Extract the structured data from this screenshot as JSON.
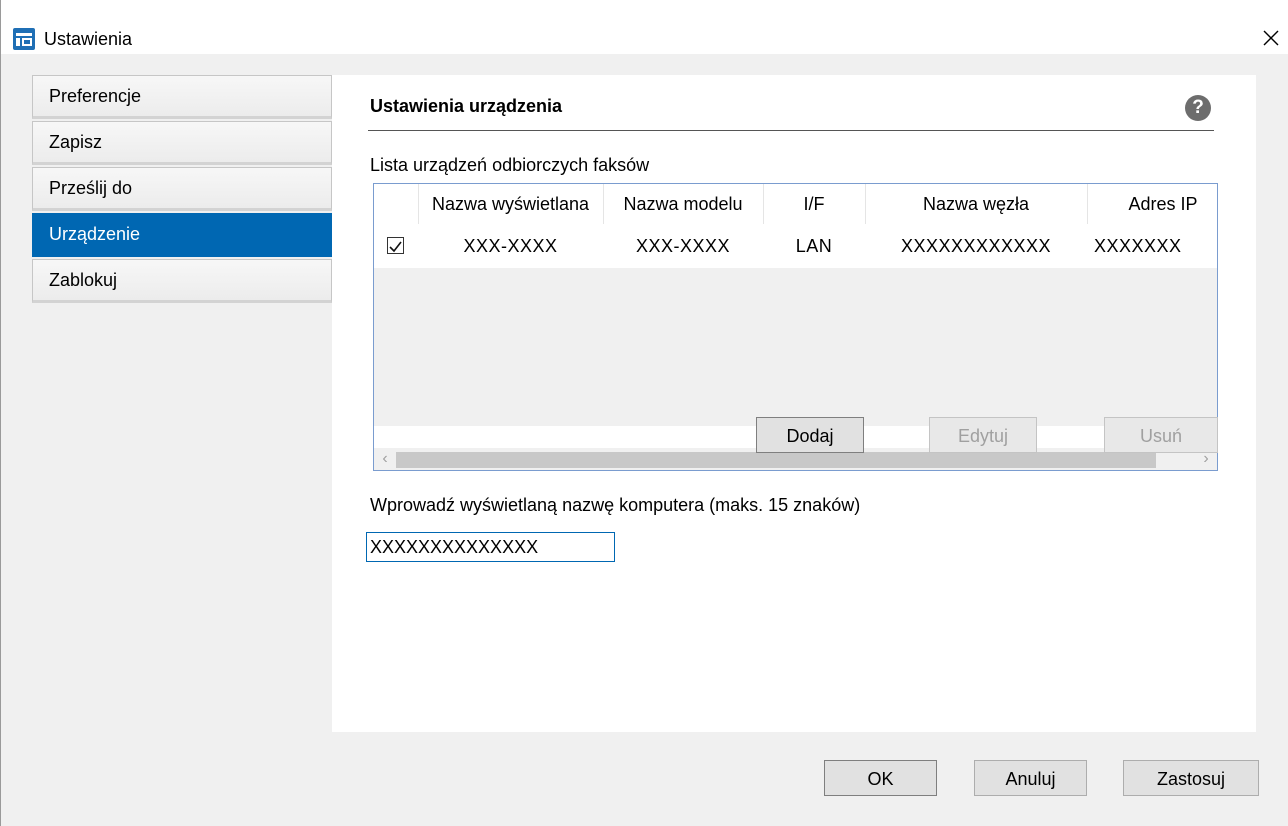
{
  "window": {
    "title": "Ustawienia",
    "close_glyph": "✕",
    "app_icon": "settings-window-icon"
  },
  "nav": {
    "items": [
      {
        "label": "Preferencje",
        "active": false
      },
      {
        "label": "Zapisz",
        "active": false
      },
      {
        "label": "Prześlij do",
        "active": false
      },
      {
        "label": "Urządzenie",
        "active": true
      },
      {
        "label": "Zablokuj",
        "active": false
      }
    ]
  },
  "panel": {
    "title": "Ustawienia urządzenia",
    "help_glyph": "?",
    "list_label": "Lista urządzeń odbiorczych faksów",
    "table": {
      "columns": [
        "Nazwa wyświetlana",
        "Nazwa modelu",
        "I/F",
        "Nazwa węzła",
        "Adres IP"
      ],
      "rows": [
        {
          "checked": true,
          "cells": [
            "XXX-XXXX",
            "XXX-XXXX",
            "LAN",
            "XXXXXXXXXXXX",
            "XXXXXXX"
          ]
        }
      ],
      "scroll_left_glyph": "‹",
      "scroll_right_glyph": "›"
    },
    "buttons": {
      "add": "Dodaj",
      "edit": "Edytuj",
      "delete": "Usuń"
    },
    "computer_name_label": "Wprowadź wyświetlaną nazwę komputera (maks. 15 znaków)",
    "computer_name_value": "XXXXXXXXXXXXXX"
  },
  "footer": {
    "ok": "OK",
    "cancel": "Anuluj",
    "apply": "Zastosuj"
  },
  "colors": {
    "accent": "#0067b2",
    "dialog_bg": "#f0f0f0",
    "panel_bg": "#ffffff"
  }
}
